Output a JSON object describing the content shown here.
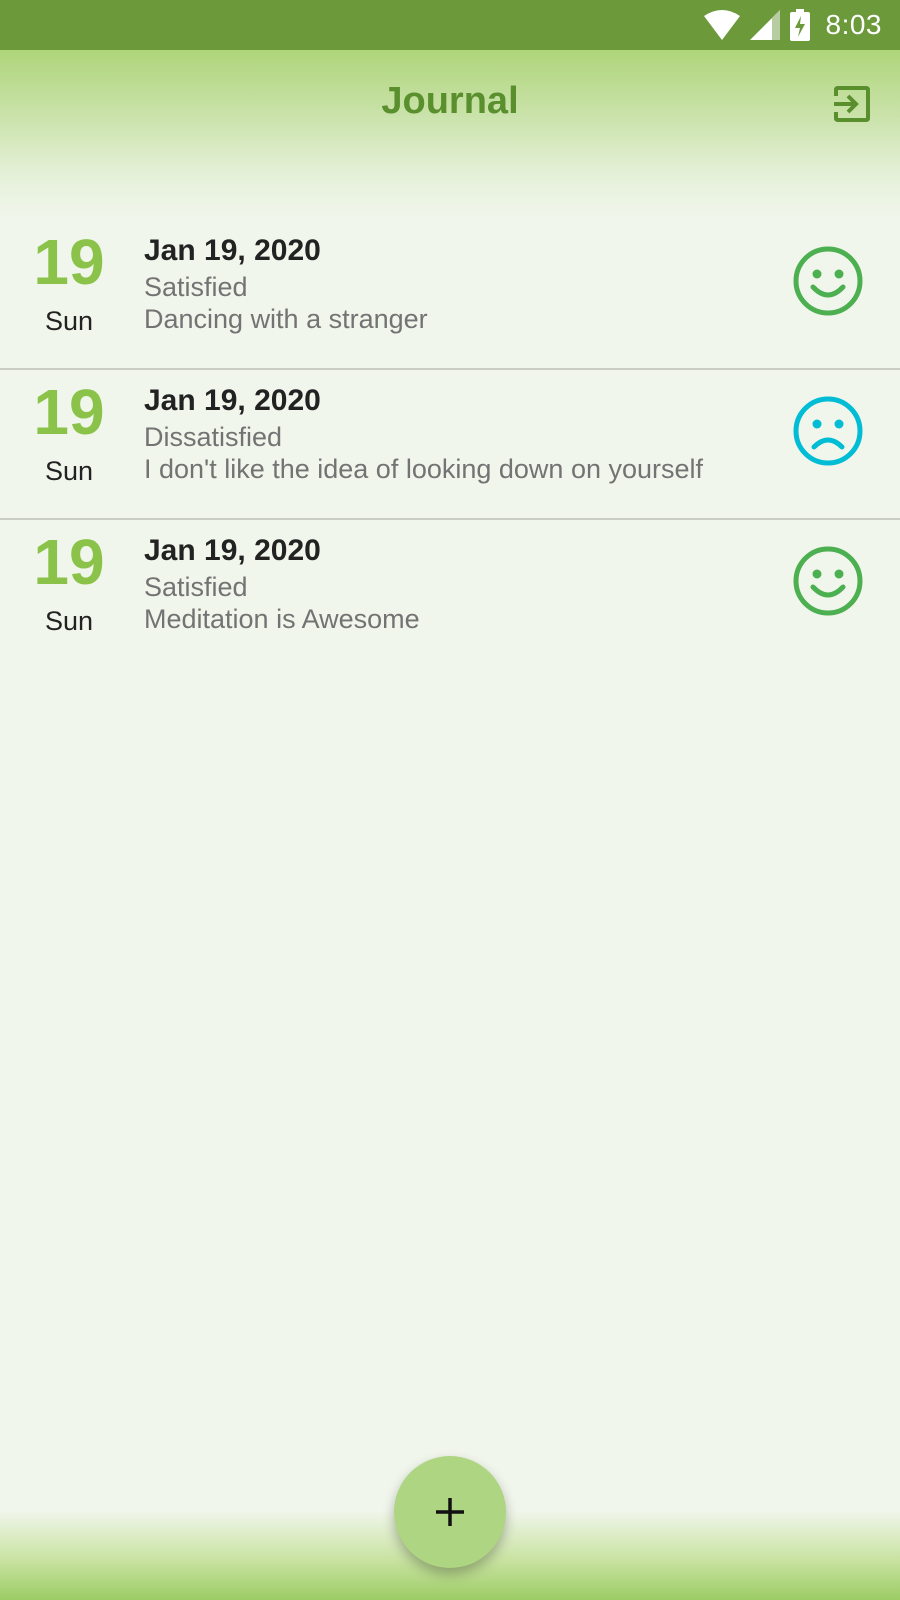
{
  "status_bar": {
    "time": "8:03",
    "icons": [
      "wifi-icon",
      "cellular-signal-icon",
      "battery-charging-icon"
    ]
  },
  "app_bar": {
    "title": "Journal",
    "action_icon": "logout-icon"
  },
  "colors": {
    "status_bar": "#6c9a3b",
    "title": "#5a8f2e",
    "day_number": "#8bc34a",
    "satisfied_icon": "#4caf50",
    "dissatisfied_icon": "#00bcd4",
    "fab": "#aed581"
  },
  "entries": [
    {
      "day_number": "19",
      "day_name": "Sun",
      "date": "Jan 19, 2020",
      "mood": "Satisfied",
      "note": "Dancing with a stranger",
      "icon": "smile-icon"
    },
    {
      "day_number": "19",
      "day_name": "Sun",
      "date": "Jan 19, 2020",
      "mood": "Dissatisfied",
      "note": "I don't like the idea of looking down on yourself",
      "icon": "frown-icon"
    },
    {
      "day_number": "19",
      "day_name": "Sun",
      "date": "Jan 19, 2020",
      "mood": "Satisfied",
      "note": "Meditation is Awesome",
      "icon": "smile-icon"
    }
  ],
  "fab": {
    "icon": "add-icon"
  }
}
